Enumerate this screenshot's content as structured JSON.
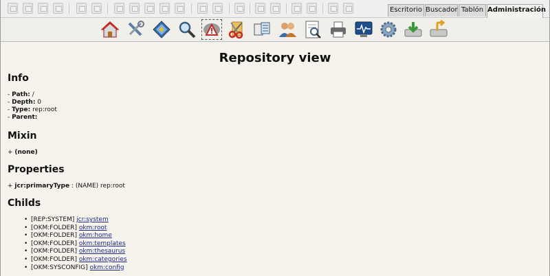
{
  "tabs": [
    "Escritorio",
    "Buscador",
    "Tablón",
    "Administración"
  ],
  "toolbar_icons": [
    "create-folder-icon",
    "add-document-icon",
    "add-subscription-icon",
    "delete-icon",
    "lock-icon",
    "unlock-icon",
    "edit-icon",
    "checkout-icon",
    "checkin-icon",
    "cancel-checkout-icon",
    "add-property-group-icon",
    "remove-property-group-icon",
    "workflow-icon",
    "add-bookmark-icon",
    "home-icon",
    "refresh-icon",
    "find-icon",
    "download-icon",
    "download-pdf-icon"
  ],
  "admin_icons": [
    "home-icon",
    "tools-icon",
    "navigator-icon",
    "search-icon",
    "repository-view-icon",
    "scissors-icon",
    "tables-icon",
    "users-icon",
    "report-icon",
    "printer-icon",
    "monitor-icon",
    "gear-icon",
    "import-icon",
    "export-icon"
  ],
  "page": {
    "title": "Repository view",
    "info": {
      "heading": "Info",
      "path_label": "Path:",
      "path_value": " /",
      "depth_label": "Depth:",
      "depth_value": " 0",
      "type_label": "Type:",
      "type_value": " rep:root",
      "parent_label": "Parent:",
      "parent_value": ""
    },
    "mixin": {
      "heading": "Mixin",
      "value": "(none)"
    },
    "properties": {
      "heading": "Properties",
      "name": "jcr:primaryType",
      "value": " : (NAME) rep:root"
    },
    "childs": {
      "heading": "Childs",
      "items": [
        {
          "type": "[REP:SYSTEM]",
          "name": "jcr:system"
        },
        {
          "type": "[OKM:FOLDER]",
          "name": "okm:root"
        },
        {
          "type": "[OKM:FOLDER]",
          "name": "okm:home"
        },
        {
          "type": "[OKM:FOLDER]",
          "name": "okm:templates"
        },
        {
          "type": "[OKM:FOLDER]",
          "name": "okm:thesaurus"
        },
        {
          "type": "[OKM:FOLDER]",
          "name": "okm:categories"
        },
        {
          "type": "[OKM:SYSCONFIG]",
          "name": "okm:config"
        }
      ]
    }
  }
}
